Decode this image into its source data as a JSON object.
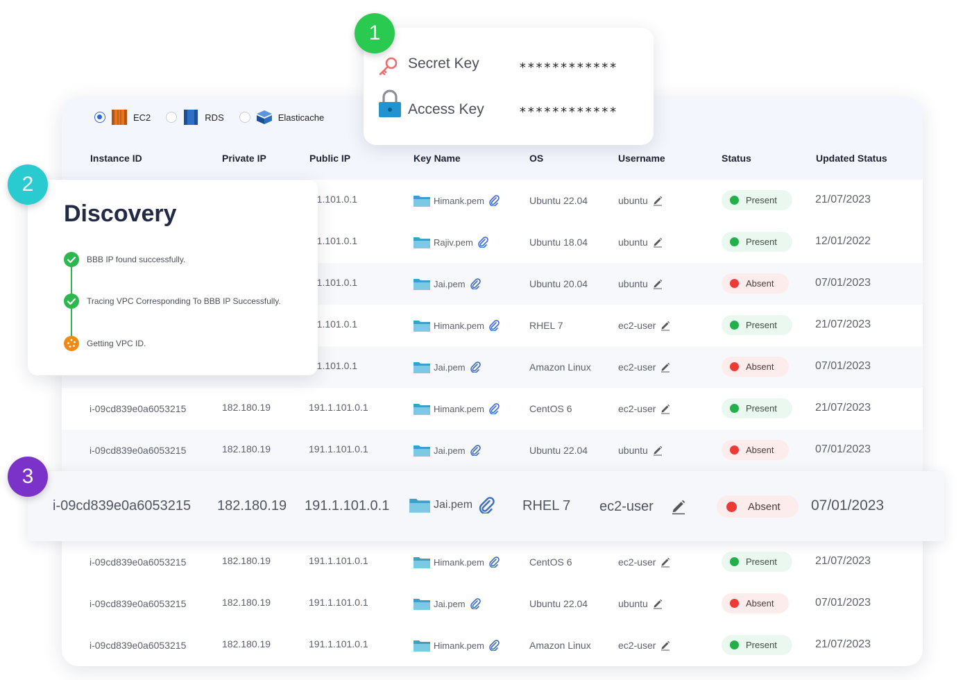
{
  "resource_types": [
    {
      "label": "EC2",
      "selected": true,
      "icon": "ec2-icon",
      "color": "#e8741e"
    },
    {
      "label": "RDS",
      "selected": false,
      "icon": "rds-icon",
      "color": "#2e6fc4"
    },
    {
      "label": "Elasticache",
      "selected": false,
      "icon": "elasticache-icon",
      "color": "#2e6fc4"
    }
  ],
  "table": {
    "headers": [
      "Instance ID",
      "Private IP",
      "Public IP",
      "Key Name",
      "OS",
      "Username",
      "Status",
      "Updated Status"
    ],
    "rows": [
      {
        "id": "",
        "private_ip": "",
        "public_ip": "1.1.101.0.1",
        "key": "Himank.pem",
        "os": "Ubuntu 22.04",
        "user": "ubuntu",
        "status": "Present",
        "date": "21/07/2023"
      },
      {
        "id": "",
        "private_ip": "",
        "public_ip": "1.1.101.0.1",
        "key": "Rajiv.pem",
        "os": "Ubuntu 18.04",
        "user": "ubuntu",
        "status": "Present",
        "date": "12/01/2022"
      },
      {
        "id": "",
        "private_ip": "",
        "public_ip": "1.1.101.0.1",
        "key": "Jai.pem",
        "os": "Ubuntu 20.04",
        "user": "ubuntu",
        "status": "Absent",
        "date": "07/01/2023"
      },
      {
        "id": "",
        "private_ip": "",
        "public_ip": "1.1.101.0.1",
        "key": "Himank.pem",
        "os": "RHEL 7",
        "user": "ec2-user",
        "status": "Present",
        "date": "21/07/2023"
      },
      {
        "id": "",
        "private_ip": "",
        "public_ip": "1.1.101.0.1",
        "key": "Jai.pem",
        "os": "Amazon Linux",
        "user": "ec2-user",
        "status": "Absent",
        "date": "07/01/2023"
      },
      {
        "id": "i-09cd839e0a6053215",
        "private_ip": "182.180.19",
        "public_ip": "191.1.101.0.1",
        "key": "Himank.pem",
        "os": "CentOS 6",
        "user": "ec2-user",
        "status": "Present",
        "date": "21/07/2023"
      },
      {
        "id": "i-09cd839e0a6053215",
        "private_ip": "182.180.19",
        "public_ip": "191.1.101.0.1",
        "key": "Jai.pem",
        "os": "Ubuntu 22.04",
        "user": "ubuntu",
        "status": "Absent",
        "date": "07/01/2023"
      },
      {
        "id": "i-09cd839e0a6053215",
        "private_ip": "182.180.19",
        "public_ip": "191.1.101.0.1",
        "key": "Himank.pem",
        "os": "CentOS 6",
        "user": "ec2-user",
        "status": "Present",
        "date": "21/07/2023"
      },
      {
        "id": "i-09cd839e0a6053215",
        "private_ip": "182.180.19",
        "public_ip": "191.1.101.0.1",
        "key": "Jai.pem",
        "os": "Ubuntu 22.04",
        "user": "ubuntu",
        "status": "Absent",
        "date": "07/01/2023"
      },
      {
        "id": "i-09cd839e0a6053215",
        "private_ip": "182.180.19",
        "public_ip": "191.1.101.0.1",
        "key": "Himank.pem",
        "os": "Amazon Linux",
        "user": "ec2-user",
        "status": "Present",
        "date": "21/07/2023"
      }
    ]
  },
  "highlight_row": {
    "id": "i-09cd839e0a6053215",
    "private_ip": "182.180.19",
    "public_ip": "191.1.101.0.1",
    "key": "Jai.pem",
    "os": "RHEL 7",
    "user": "ec2-user",
    "status": "Absent",
    "date": "07/01/2023"
  },
  "credentials": {
    "secret_label": "Secret Key",
    "secret_value": "************",
    "access_label": "Access Key",
    "access_value": "************"
  },
  "discovery": {
    "title": "Discovery",
    "steps": [
      {
        "label": "BBB IP found successfully.",
        "state": "done"
      },
      {
        "label": "Tracing VPC Corresponding To BBB IP Successfully.",
        "state": "done"
      },
      {
        "label": "Getting VPC ID.",
        "state": "loading"
      }
    ]
  },
  "callouts": [
    "1",
    "2",
    "3"
  ],
  "colors": {
    "present_dot": "#22b04b",
    "absent_dot": "#ec3a35",
    "callout_1": "#2ac94f",
    "callout_2": "#29cbd1",
    "callout_3": "#7b32c9",
    "header_bg": "#f4f6fd"
  }
}
